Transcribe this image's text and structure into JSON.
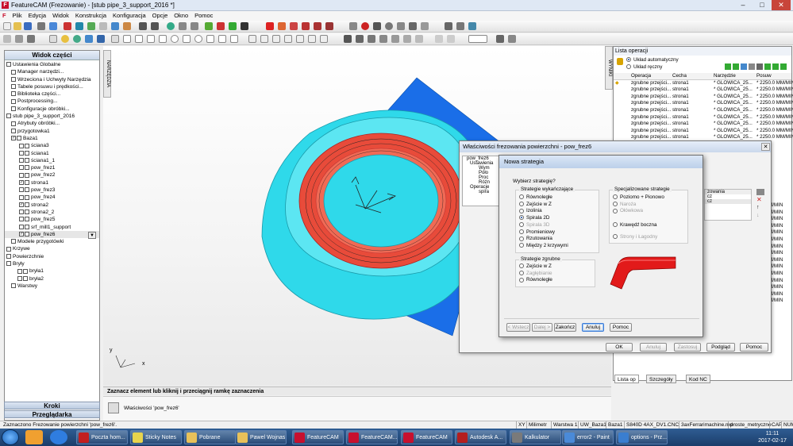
{
  "window": {
    "title": "FeatureCAM (Frezowanie) - [stub pipe_3_support_2016 *]",
    "app_icon": "F",
    "controls": [
      "–",
      "□",
      "✕"
    ]
  },
  "menu": [
    "Plik",
    "Edycja",
    "Widok",
    "Konstrukcja",
    "Konfiguracja",
    "Opcje",
    "Okno",
    "Pomoc"
  ],
  "left_panel": {
    "title": "Widok części",
    "items": [
      {
        "label": "Ustawienia Globalne",
        "check": null,
        "icon": "globe-icon"
      },
      {
        "label": "Manager narzędzi...",
        "check": null,
        "icon": "tool-manager-icon"
      },
      {
        "label": "Wrzeciona i Uchwyty Narzędzia",
        "check": null,
        "icon": "spindle-icon"
      },
      {
        "label": "Tabele posuwu i prędkości...",
        "check": null,
        "icon": "table-icon"
      },
      {
        "label": "Biblioteka części...",
        "check": null,
        "icon": "library-icon"
      },
      {
        "label": "Postprocessing...",
        "check": null,
        "icon": "post-icon"
      },
      {
        "label": "Konfiguracje obróbki...",
        "check": null,
        "icon": "config-icon"
      },
      {
        "label": "stub pipe_3_support_2016",
        "check": null,
        "icon": "part-icon"
      },
      {
        "label": "Atrybuty obróbki...",
        "check": null,
        "icon": "attributes-icon"
      },
      {
        "label": "przygotowka1",
        "check": null,
        "icon": "stock-icon"
      },
      {
        "label": "Baza1",
        "check": "✓",
        "icon": "setup-icon"
      },
      {
        "label": "ściana3",
        "check": "",
        "icon": "feature-icon"
      },
      {
        "label": "ściana1",
        "check": "",
        "icon": "feature-icon"
      },
      {
        "label": "ściana1_1",
        "check": "",
        "icon": "feature-icon"
      },
      {
        "label": "pow_frez1",
        "check": "",
        "icon": "feature-icon"
      },
      {
        "label": "pow_frez2",
        "check": "",
        "icon": "feature-icon"
      },
      {
        "label": "strona1",
        "check": "✓",
        "icon": "feature-icon"
      },
      {
        "label": "pow_frez3",
        "check": "",
        "icon": "feature-icon"
      },
      {
        "label": "pow_frez4",
        "check": "",
        "icon": "feature-icon"
      },
      {
        "label": "strona2",
        "check": "✓",
        "icon": "feature-icon"
      },
      {
        "label": "strona2_2",
        "check": "",
        "icon": "feature-icon"
      },
      {
        "label": "pow_frez5",
        "check": "",
        "icon": "feature-icon"
      },
      {
        "label": "srf_mill1_support",
        "check": "",
        "icon": "feature-icon"
      },
      {
        "label": "pow_frez6",
        "check": "✓",
        "icon": "feature-icon"
      },
      {
        "label": "Modele przygotówki",
        "check": null,
        "icon": "stock-model-icon"
      },
      {
        "label": "Krzywe",
        "check": null,
        "icon": "curve-icon"
      },
      {
        "label": "Powierzchnie",
        "check": null,
        "icon": "surface-icon"
      },
      {
        "label": "Bryły",
        "check": null,
        "icon": "solid-icon"
      },
      {
        "label": "bryła1",
        "check": "",
        "icon": "solid-icon"
      },
      {
        "label": "bryła2",
        "check": "",
        "icon": "solid-icon"
      },
      {
        "label": "Warstwy",
        "check": null,
        "icon": "layers-icon"
      }
    ],
    "buttons": {
      "krok": "Kroki",
      "browser": "Przeglądarka"
    }
  },
  "vtabs": {
    "left": "NARZĘDZIA",
    "right": "WYNIKI"
  },
  "viewport": {
    "axis_y": "y",
    "axis_x": "x",
    "cursor": "↰"
  },
  "status_message": "Zaznacz element lub kliknij i przeciągnij ramkę zaznaczenia",
  "property_text": "Właściwości 'pow_frez6'",
  "right_panel": {
    "title": "Lista operacji",
    "radio_auto": "Układ automatyczny",
    "radio_manual": "Układ ręczny",
    "columns": [
      "Operacja",
      "Cecha",
      "Narzędzie",
      "Posuw"
    ],
    "rows": [
      [
        "zgrubne przejści...",
        "strona1",
        "* GLOWICA_25...",
        "* 2250.0 MM/MIN"
      ],
      [
        "zgrubne przejści...",
        "strona1",
        "* GLOWICA_25...",
        "* 2250.0 MM/MIN"
      ],
      [
        "zgrubne przejści...",
        "strona1",
        "* GLOWICA_25...",
        "* 2250.0 MM/MIN"
      ],
      [
        "zgrubne przejści...",
        "strona1",
        "* GLOWICA_25...",
        "* 2250.0 MM/MIN"
      ],
      [
        "zgrubne przejści...",
        "strona1",
        "* GLOWICA_25...",
        "* 2250.0 MM/MIN"
      ],
      [
        "zgrubne przejści...",
        "strona1",
        "* GLOWICA_25...",
        "* 2250.0 MM/MIN"
      ],
      [
        "zgrubne przejści...",
        "strona1",
        "* GLOWICA_25...",
        "* 2250.0 MM/MIN"
      ],
      [
        "zgrubne przejści...",
        "strona1",
        "* GLOWICA_25...",
        "* 2250.0 MM/MIN"
      ],
      [
        "zgrubne przejści...",
        "strona1",
        "* GLOWICA_25...",
        "* 2250.0 MM/MIN"
      ]
    ],
    "partial_rows": [
      "MM/MIN",
      "MM/MIN",
      "MM/MIN",
      "MM/MIN",
      "MM/MIN",
      "MM/MIN",
      "MM/MIN",
      "MM/MIN",
      "MM/MIN",
      "MM/MIN",
      "MM/MIN",
      "MM/MIN",
      "MM/MIN",
      "MM/MIN",
      "MM/MIN"
    ],
    "tabs": [
      "Lista op",
      "Szczegóły",
      "Kod NC"
    ]
  },
  "dialog_props": {
    "title": "Właściwości frezowania powierzchni - pow_frez6",
    "tree": [
      "pow_frez6",
      "Ustawienia",
      "Wym",
      "Poło",
      "Proc",
      "Różn",
      "Operacje",
      "spira"
    ],
    "col_header": "zowania",
    "col_values": [
      "cz",
      "cz"
    ],
    "buttons": {
      "ok": "OK",
      "cancel": "Anuluj",
      "apply": "Zastosuj",
      "help_text": "Podgląd",
      "help": "Pomoc"
    }
  },
  "dialog_strategy": {
    "title": "Nowa strategia",
    "question": "Wybierz strategię?",
    "finishing_label": "Strategie wykańczające",
    "finishing": [
      {
        "label": "Równoległe",
        "on": false,
        "dis": false
      },
      {
        "label": "Zejście w Z",
        "on": false,
        "dis": false
      },
      {
        "label": "Izolinia",
        "on": false,
        "dis": false
      },
      {
        "label": "Spirala 2D",
        "on": true,
        "dis": false
      },
      {
        "label": "Spirala 3D",
        "on": false,
        "dis": true
      },
      {
        "label": "Promieniowy",
        "on": false,
        "dis": false
      },
      {
        "label": "Rzutowania",
        "on": false,
        "dis": false
      },
      {
        "label": "Między 2 krzywymi",
        "on": false,
        "dis": false
      }
    ],
    "special_label": "Specjalizowane strategie",
    "special": [
      {
        "label": "Poziomo + Pionowo",
        "on": false,
        "dis": false
      },
      {
        "label": "Naroża",
        "on": false,
        "dis": true
      },
      {
        "label": "Ołówkowa",
        "on": false,
        "dis": true
      },
      {
        "label": "Krawędź boczna",
        "on": false,
        "dis": false
      },
      {
        "label": "Strony i Łagodny",
        "on": false,
        "dis": true
      }
    ],
    "roughing_label": "Strategie zgrubne",
    "roughing": [
      {
        "label": "Zejście w Z",
        "on": false,
        "dis": false
      },
      {
        "label": "Zagłębianie",
        "on": false,
        "dis": true
      },
      {
        "label": "Równoległe",
        "on": false,
        "dis": false
      }
    ],
    "buttons": {
      "back": "< Wstecz",
      "next": "Dalej >",
      "finish": "Zakończ",
      "cancel": "Anuluj",
      "help": "Pomoc"
    }
  },
  "status_bar": [
    "XY",
    "Milimetr",
    "Warstwa 1",
    "UW_Baza1",
    "Baza1",
    "S840D 4AX_DV1.CNC",
    "3axFerrarimachine.md",
    "proste_metryczne",
    "CAP",
    "NUM"
  ],
  "status_left": "Zaznaczono Frezowanie powierzchni 'pow_frez6'.",
  "taskbar": [
    {
      "label": "Poczta hom...",
      "color": "#c21f1f"
    },
    {
      "label": "Sticky Notes",
      "color": "#e8d44d"
    },
    {
      "label": "Pobrane",
      "color": "#e8c15a"
    },
    {
      "label": "Pawel Wojnas",
      "color": "#e8c15a"
    },
    {
      "label": "FeatureCAM",
      "color": "#c8102e"
    },
    {
      "label": "FeatureCAM...",
      "color": "#c8102e"
    },
    {
      "label": "FeatureCAM",
      "color": "#c8102e"
    },
    {
      "label": "Autodesk A...",
      "color": "#b41e1e"
    },
    {
      "label": "Kalkulator",
      "color": "#7a7a7a"
    },
    {
      "label": "error2 - Paint",
      "color": "#4a8ad8"
    },
    {
      "label": "options - Prz...",
      "color": "#3a7ed0"
    }
  ],
  "clock": {
    "time": "11:11",
    "date": "2017-02-17"
  }
}
